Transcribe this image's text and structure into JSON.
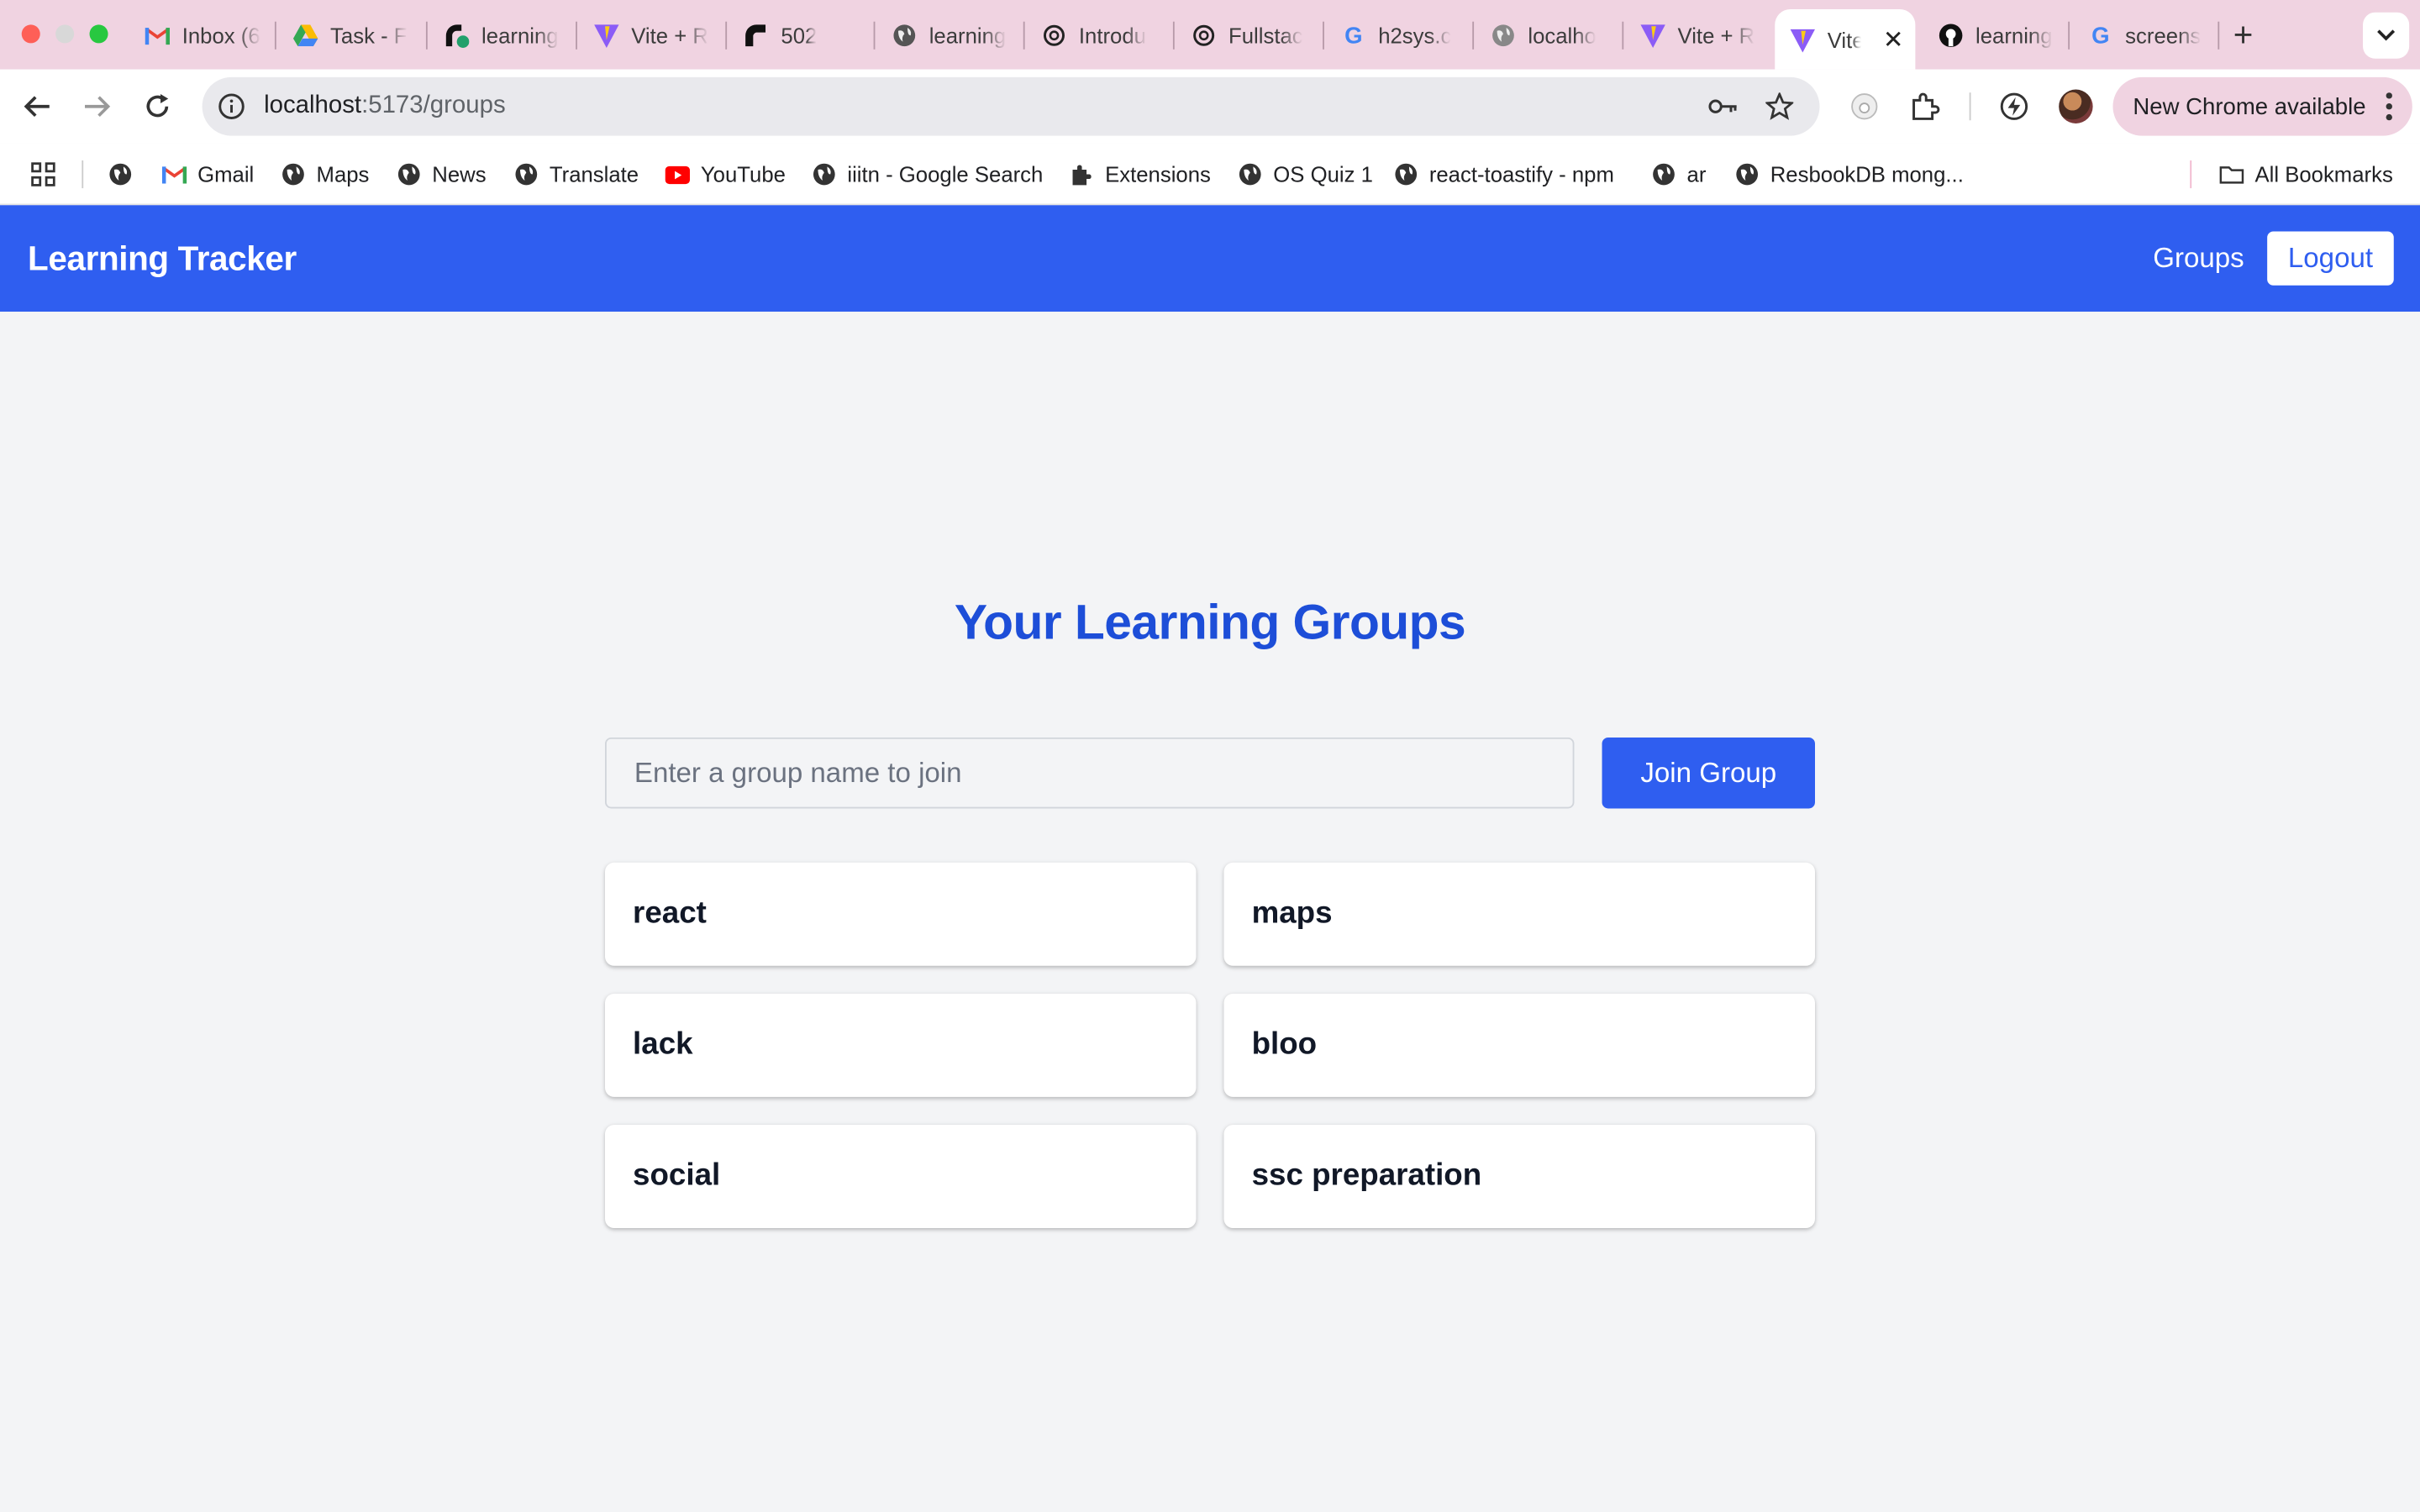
{
  "browser": {
    "tabs": [
      {
        "title": "Inbox (6",
        "icon": "gmail-icon"
      },
      {
        "title": "Task - F",
        "icon": "google-drive-icon"
      },
      {
        "title": "learning",
        "icon": "render-icon"
      },
      {
        "title": "Vite + R",
        "icon": "vite-icon"
      },
      {
        "title": "502",
        "icon": "render-icon"
      },
      {
        "title": "learning",
        "icon": "globe-icon"
      },
      {
        "title": "Introdu",
        "icon": "openai-icon"
      },
      {
        "title": "Fullstac",
        "icon": "openai-icon"
      },
      {
        "title": "h2sys.c",
        "icon": "google-icon"
      },
      {
        "title": "localho",
        "icon": "globe-icon"
      },
      {
        "title": "Vite + R",
        "icon": "vite-icon"
      },
      {
        "title": "Vite",
        "icon": "vite-icon",
        "active": true
      },
      {
        "title": "learning",
        "icon": "github-icon"
      },
      {
        "title": "screens",
        "icon": "google-icon"
      }
    ],
    "url_host": "localhost",
    "url_path": ":5173/groups",
    "update_label": "New Chrome available",
    "bookmarks": [
      {
        "label": "Gmail",
        "icon": "gmail-icon"
      },
      {
        "label": "Maps",
        "icon": "globe-icon"
      },
      {
        "label": "News",
        "icon": "globe-icon"
      },
      {
        "label": "Translate",
        "icon": "globe-icon"
      },
      {
        "label": "YouTube",
        "icon": "youtube-icon"
      },
      {
        "label": "iiitn - Google Search",
        "icon": "globe-icon"
      },
      {
        "label": "Extensions",
        "icon": "puzzle-icon"
      },
      {
        "label": "OS Quiz 1",
        "icon": "globe-icon"
      },
      {
        "label": "react-toastify - npm",
        "icon": "globe-icon"
      },
      {
        "label": "ar",
        "icon": "globe-icon"
      },
      {
        "label": "ResbookDB mong...",
        "icon": "globe-icon"
      }
    ],
    "all_bookmarks_label": "All Bookmarks"
  },
  "app": {
    "brand": "Learning Tracker",
    "nav": {
      "groups": "Groups",
      "logout": "Logout"
    },
    "heading": "Your Learning Groups",
    "join": {
      "placeholder": "Enter a group name to join",
      "button": "Join Group"
    },
    "groups": [
      "react",
      "maps",
      "lack",
      "bloo",
      "social",
      "ssc preparation"
    ],
    "colors": {
      "primary": "#2f5ef0",
      "heading": "#1d4ed8",
      "background": "#f3f4f6"
    }
  }
}
